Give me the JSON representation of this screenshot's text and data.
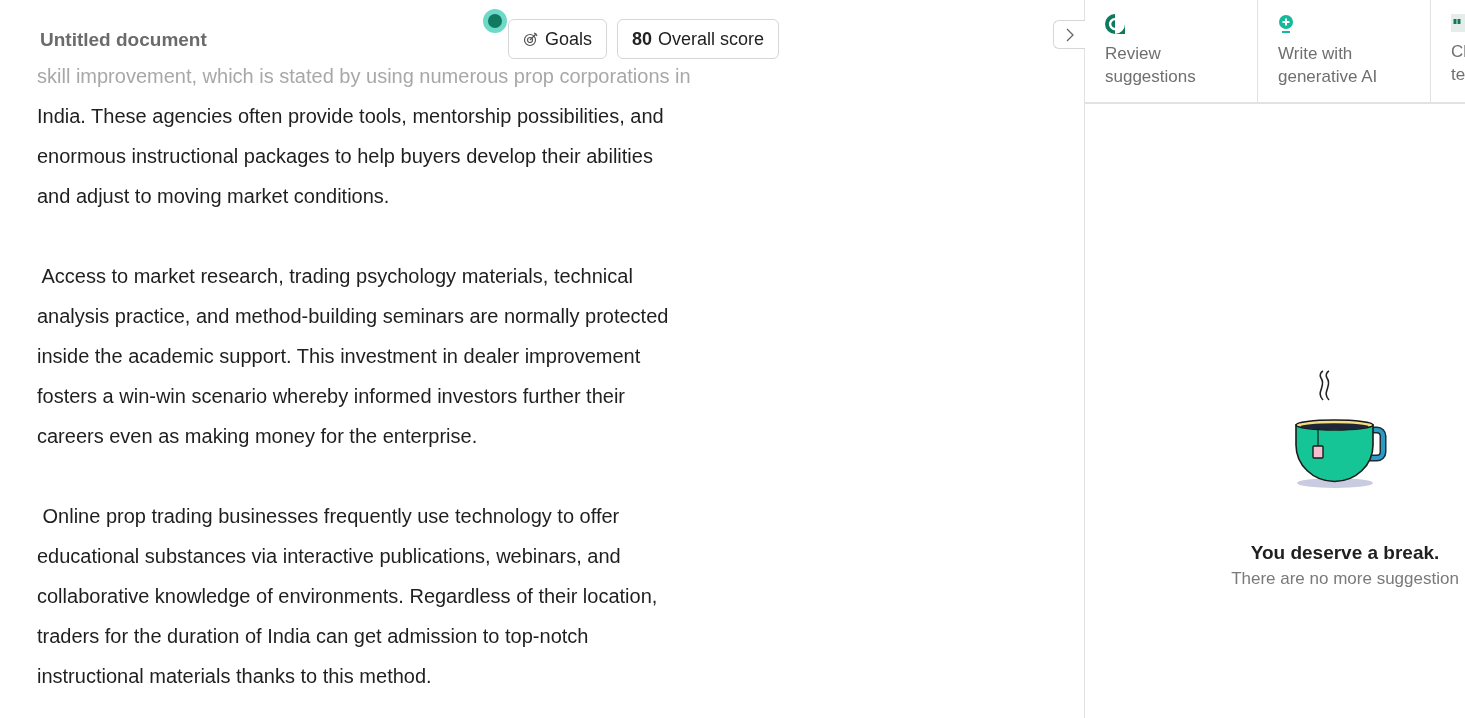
{
  "document": {
    "title": "Untitled document",
    "paragraphs": [
      {
        "lines": [
          "skill improvement, which is stated by using numerous prop corporations in",
          "India. These agencies often provide tools, mentorship possibilities, and",
          "enormous instructional packages to help buyers develop their abilities",
          "and adjust to moving market conditions."
        ]
      },
      {
        "lines": [
          " Access to market research, trading psychology materials, technical",
          "analysis practice, and method-building seminars are normally protected",
          "inside the academic support. This investment in dealer improvement",
          "fosters a win-win scenario whereby informed investors further their",
          "careers even as making money for the enterprise."
        ]
      },
      {
        "lines": [
          " Online prop trading businesses frequently use technology to offer",
          "educational substances via interactive publications, webinars, and",
          "collaborative knowledge of environments. Regardless of their location,",
          "traders for the duration of India can get admission to top-notch",
          "instructional materials thanks to this method."
        ]
      }
    ]
  },
  "toolbar": {
    "goals": "Goals",
    "score": "80",
    "score_label": "Overall score"
  },
  "panel": {
    "tabs": [
      {
        "kind": "review",
        "lines": [
          "Review",
          "suggestions"
        ]
      },
      {
        "kind": "ai",
        "lines": [
          "Write with",
          "generative AI"
        ]
      },
      {
        "kind": "quote",
        "lines": [
          "Cl",
          "te"
        ]
      }
    ],
    "empty_title": "You deserve a break.",
    "empty_text": "There are no more suggestion"
  }
}
